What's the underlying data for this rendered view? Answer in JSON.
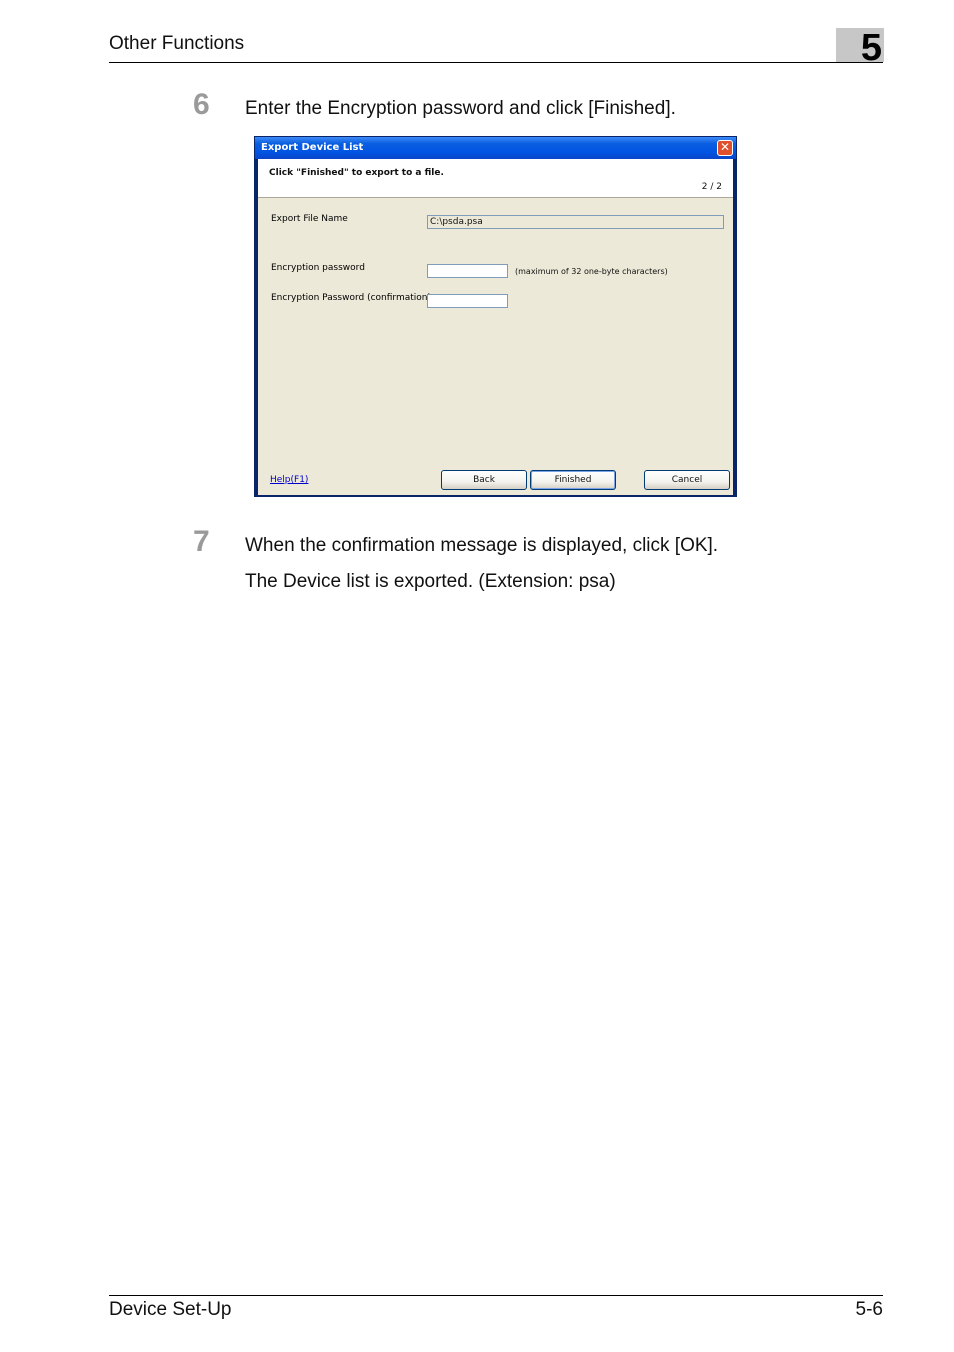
{
  "header": {
    "section_title": "Other Functions",
    "chapter_number": "5"
  },
  "steps": [
    {
      "number": "6",
      "text": "Enter the Encryption password and click [Finished]."
    },
    {
      "number": "7",
      "text": "When the confirmation message is displayed, click [OK].",
      "result": "The Device list is exported. (Extension: psa)"
    }
  ],
  "dialog": {
    "title": "Export Device List",
    "close_glyph": "✕",
    "instruction": "Click \"Finished\" to export to a file.",
    "page_indicator": "2 / 2",
    "export_file_label": "Export File Name",
    "export_file_value": "C:\\psda.psa",
    "encryption_label": "Encryption password",
    "encryption_value": "",
    "encryption_note": "(maximum of 32 one-byte characters)",
    "confirm_label": "Encryption Password (confirmation)",
    "confirm_value": "",
    "help_link": "Help(F1)",
    "back_button": "Back",
    "finished_button": "Finished",
    "cancel_button": "Cancel"
  },
  "footer": {
    "left": "Device Set-Up",
    "right": "5-6"
  }
}
